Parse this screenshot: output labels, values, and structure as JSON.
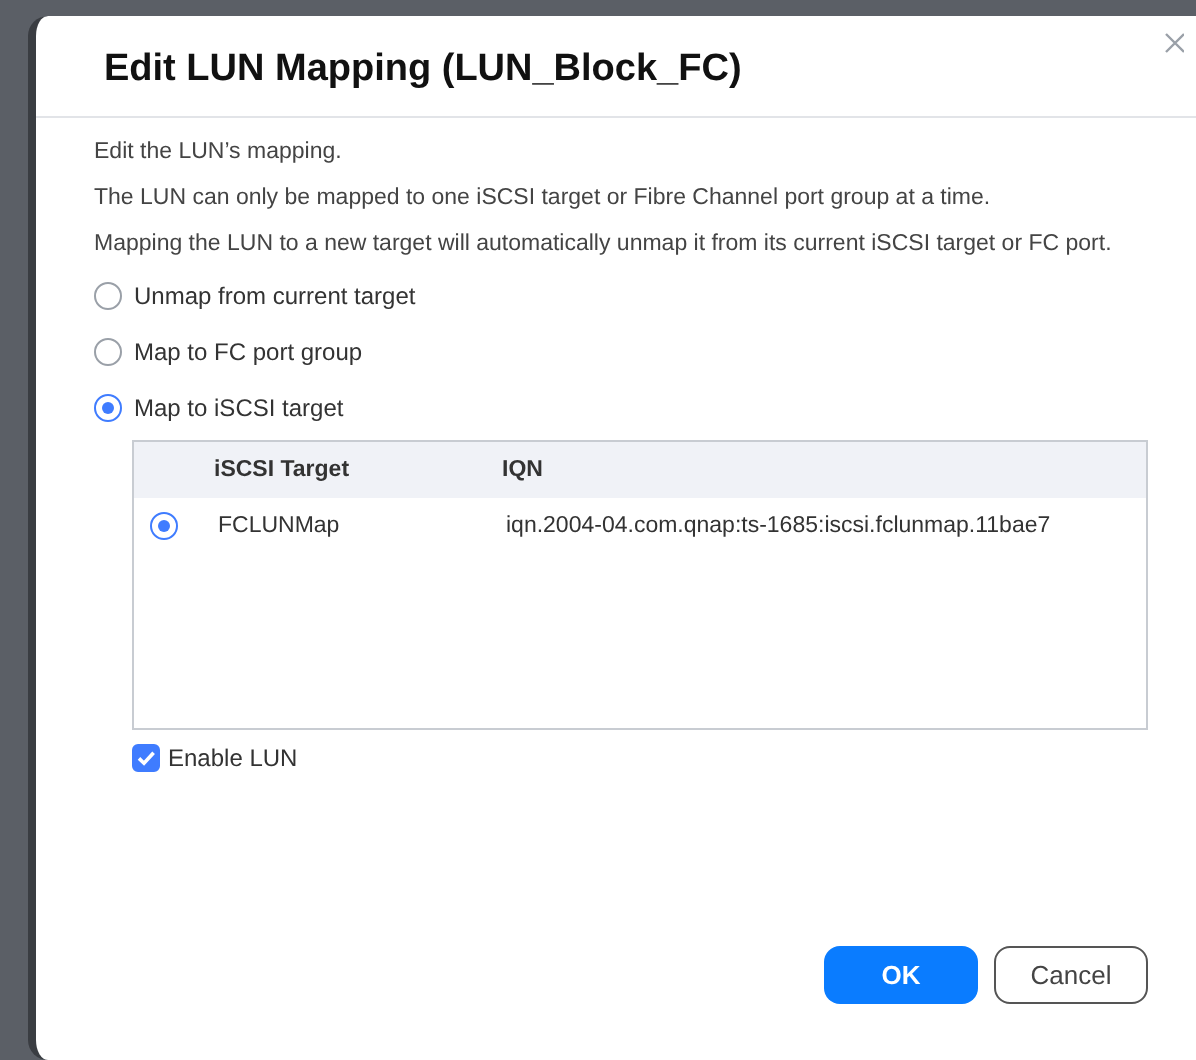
{
  "dialog": {
    "title": "Edit LUN Mapping (LUN_Block_FC)"
  },
  "description": [
    "Edit the LUN’s mapping.",
    "The LUN can only be mapped to one iSCSI target or Fibre Channel port group at a time.",
    "Mapping the LUN to a new target will automatically unmap it from its current iSCSI target or FC port."
  ],
  "options": [
    {
      "label": "Unmap from current target",
      "selected": false
    },
    {
      "label": "Map to FC port group",
      "selected": false
    },
    {
      "label": "Map to iSCSI target",
      "selected": true
    }
  ],
  "table": {
    "columns": [
      "iSCSI Target",
      "IQN"
    ],
    "rows": [
      {
        "selected": true,
        "cells": [
          "FCLUNMap",
          "iqn.2004-04.com.qnap:ts-1685:iscsi.fclunmap.11bae7"
        ]
      }
    ]
  },
  "enable_lun": {
    "label": "Enable LUN",
    "checked": true
  },
  "buttons": [
    {
      "label": "OK",
      "kind": "primary"
    },
    {
      "label": "Cancel",
      "kind": "secondary"
    }
  ]
}
